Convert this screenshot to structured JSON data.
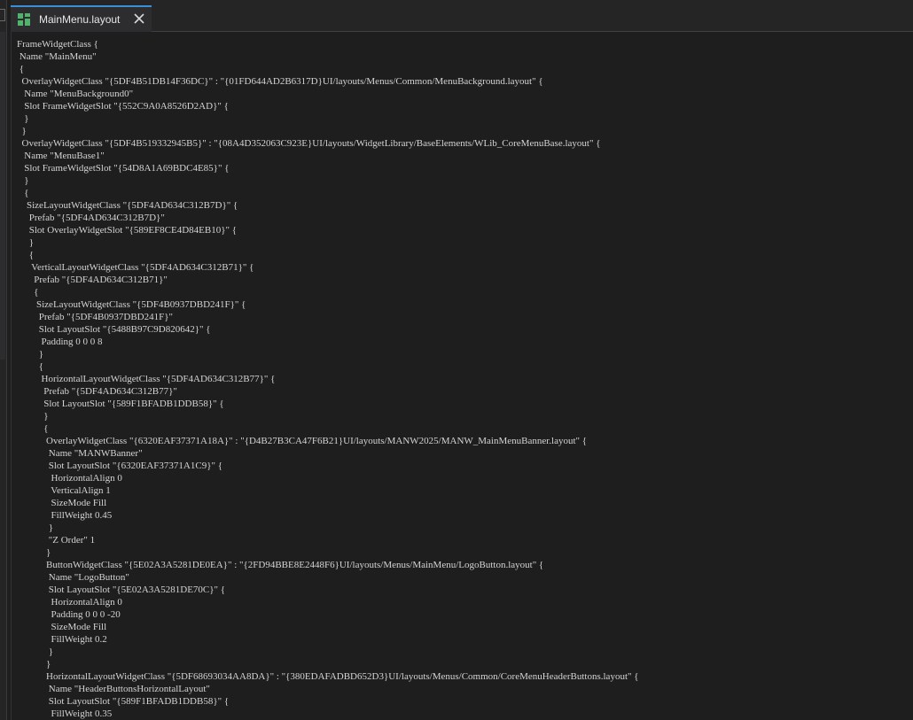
{
  "tab": {
    "title": "MainMenu.layout",
    "icon": "layout-grid-icon",
    "close_icon": "close-icon",
    "accent_color": "#3b8ed8"
  },
  "editor": {
    "lines": [
      "FrameWidgetClass {",
      " Name \"MainMenu\"",
      " {",
      "  OverlayWidgetClass \"{5DF4B51DB14F36DC}\" : \"{01FD644AD2B6317D}UI/layouts/Menus/Common/MenuBackground.layout\" {",
      "   Name \"MenuBackground0\"",
      "   Slot FrameWidgetSlot \"{552C9A0A8526D2AD}\" {",
      "   }",
      "  }",
      "  OverlayWidgetClass \"{5DF4B519332945B5}\" : \"{08A4D352063C923E}UI/layouts/WidgetLibrary/BaseElements/WLib_CoreMenuBase.layout\" {",
      "   Name \"MenuBase1\"",
      "   Slot FrameWidgetSlot \"{54D8A1A69BDC4E85}\" {",
      "   }",
      "   {",
      "    SizeLayoutWidgetClass \"{5DF4AD634C312B7D}\" {",
      "     Prefab \"{5DF4AD634C312B7D}\"",
      "     Slot OverlayWidgetSlot \"{589EF8CE4D84EB10}\" {",
      "     }",
      "     {",
      "      VerticalLayoutWidgetClass \"{5DF4AD634C312B71}\" {",
      "       Prefab \"{5DF4AD634C312B71}\"",
      "       {",
      "        SizeLayoutWidgetClass \"{5DF4B0937DBD241F}\" {",
      "         Prefab \"{5DF4B0937DBD241F}\"",
      "         Slot LayoutSlot \"{5488B97C9D820642}\" {",
      "          Padding 0 0 0 8",
      "         }",
      "         {",
      "          HorizontalLayoutWidgetClass \"{5DF4AD634C312B77}\" {",
      "           Prefab \"{5DF4AD634C312B77}\"",
      "           Slot LayoutSlot \"{589F1BFADB1DDB58}\" {",
      "           }",
      "           {",
      "            OverlayWidgetClass \"{6320EAF37371A18A}\" : \"{D4B27B3CA47F6B21}UI/layouts/MANW2025/MANW_MainMenuBanner.layout\" {",
      "             Name \"MANWBanner\"",
      "             Slot LayoutSlot \"{6320EAF37371A1C9}\" {",
      "              HorizontalAlign 0",
      "              VerticalAlign 1",
      "              SizeMode Fill",
      "              FillWeight 0.45",
      "             }",
      "             \"Z Order\" 1",
      "            }",
      "            ButtonWidgetClass \"{5E02A3A5281DE0EA}\" : \"{2FD94BBE8E2448F6}UI/layouts/Menus/MainMenu/LogoButton.layout\" {",
      "             Name \"LogoButton\"",
      "             Slot LayoutSlot \"{5E02A3A5281DE70C}\" {",
      "              HorizontalAlign 0",
      "              Padding 0 0 0 -20",
      "              SizeMode Fill",
      "              FillWeight 0.2",
      "             }",
      "            }",
      "            HorizontalLayoutWidgetClass \"{5DF68693034AA8DA}\" : \"{380EDAFADBD652D3}UI/layouts/Menus/Common/CoreMenuHeaderButtons.layout\" {",
      "             Name \"HeaderButtonsHorizontalLayout\"",
      "             Slot LayoutSlot \"{589F1BFADB1DDB58}\" {",
      "              FillWeight 0.35"
    ]
  }
}
